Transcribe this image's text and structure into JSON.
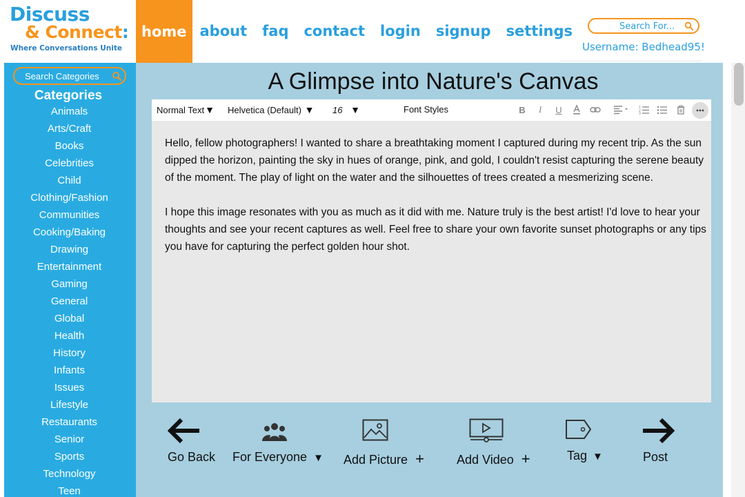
{
  "logo": {
    "line1": "Discuss",
    "line2": "& Connect",
    "line2_colon": ":",
    "tagline": "Where Conversations Unite"
  },
  "nav": {
    "items": [
      {
        "label": "home",
        "active": true
      },
      {
        "label": "about"
      },
      {
        "label": "faq"
      },
      {
        "label": "contact"
      },
      {
        "label": "login"
      },
      {
        "label": "signup"
      },
      {
        "label": "settings"
      }
    ]
  },
  "header": {
    "search_placeholder": "Search For...",
    "username": "Username: Bedhead95!"
  },
  "sidebar": {
    "search_placeholder": "Search Categories",
    "title": "Categories",
    "categories": [
      "Animals",
      "Arts/Craft",
      "Books",
      "Celebrities",
      "Child",
      "Clothing/Fashion",
      "Communities",
      "Cooking/Baking",
      "Drawing",
      "Entertainment",
      "Gaming",
      "General",
      "Global",
      "Health",
      "History",
      "Infants",
      "Issues",
      "Lifestyle",
      "Restaurants",
      "Senior",
      "Sports",
      "Technology",
      "Teen"
    ]
  },
  "post": {
    "title": "A Glimpse into Nature's Canvas",
    "paragraphs": [
      "Hello, fellow photographers! I wanted to share a breathtaking moment I captured during my recent trip. As the sun dipped the horizon, painting the sky in hues of orange, pink, and gold, I couldn't resist capturing the serene beauty of the moment. The play of light on the water and the silhouettes of trees created a mesmerizing scene.",
      "I hope this image resonates with you as much as it did with me. Nature truly is the best artist! I'd love to hear your thoughts and see your recent captures as well. Feel free to share your own favorite sunset photographs or any tips you have for capturing the perfect golden hour shot."
    ]
  },
  "toolbar": {
    "text_style": "Normal Text",
    "font_family": "Helvetica (Default)",
    "font_size": "16",
    "font_styles": "Font Styles",
    "icons": [
      "bold-icon",
      "italic-icon",
      "underline-icon",
      "font-color-icon",
      "link-icon",
      "align-icon",
      "numbered-list-icon",
      "bullet-list-icon",
      "trash-icon",
      "more-icon"
    ]
  },
  "actions": {
    "go_back": "Go Back",
    "audience": "For Everyone",
    "add_picture": "Add Picture",
    "add_video": "Add Video",
    "tag": "Tag",
    "post": "Post"
  },
  "colors": {
    "brand_blue": "#29abe2",
    "brand_orange": "#f7941d",
    "main_bg": "#a7cfe0",
    "editor_bg": "#e8e8e8"
  }
}
